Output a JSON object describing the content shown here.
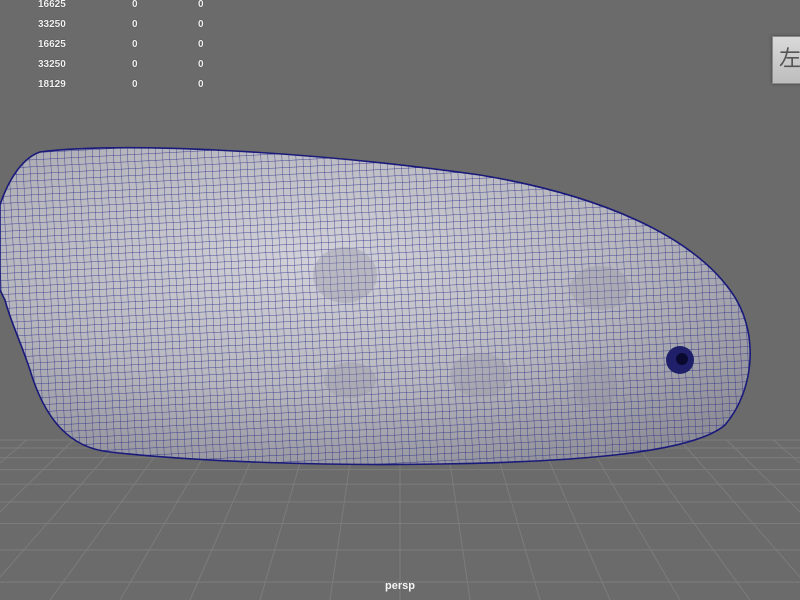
{
  "viewport": {
    "camera_name": "persp",
    "view_cube_face": "左",
    "heads_up_display": {
      "rows": [
        [
          "16625",
          "0",
          "0"
        ],
        [
          "33250",
          "0",
          "0"
        ],
        [
          "16625",
          "0",
          "0"
        ],
        [
          "33250",
          "0",
          "0"
        ],
        [
          "18129",
          "0",
          "0"
        ]
      ]
    },
    "colors": {
      "background": "#6b6b6b",
      "grid": "#7c7c7c",
      "mesh_fill": "#b9b9c0",
      "wireframe": "#1f1f86"
    },
    "model": {
      "name": "mesh-object",
      "display": "wireframe-on-shaded"
    }
  }
}
